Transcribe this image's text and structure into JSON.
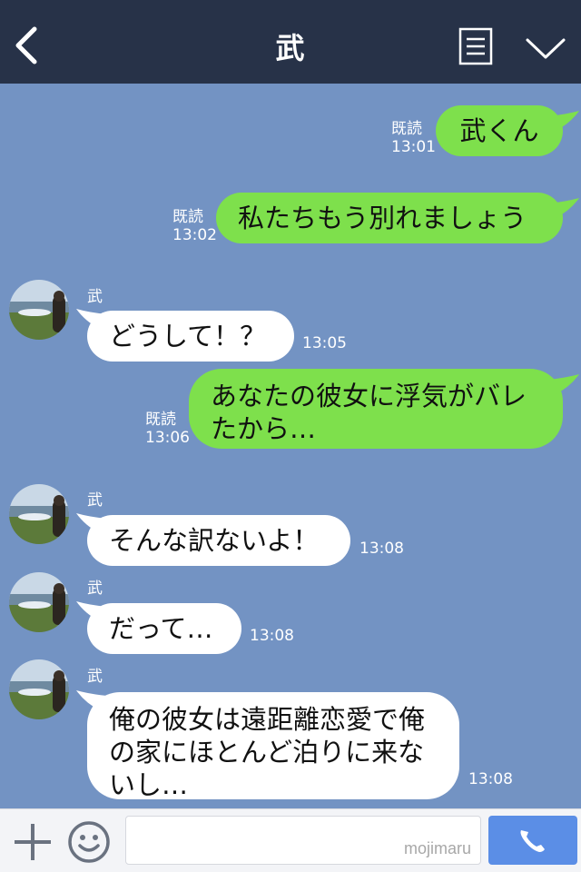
{
  "header": {
    "title": "武",
    "back_icon": "chevron-left-icon",
    "menu_icon": "list-icon",
    "more_icon": "chevron-down-icon"
  },
  "messages": [
    {
      "direction": "out",
      "text": "武くん",
      "read": "既読",
      "time": "13:01"
    },
    {
      "direction": "out",
      "text": "私たちもう別れましょう",
      "read": "既読",
      "time": "13:02"
    },
    {
      "direction": "in",
      "sender": "武",
      "text": "どうして！？",
      "time": "13:05"
    },
    {
      "direction": "out",
      "lines": [
        "あなたの彼女に浮気がバレ",
        "たから…"
      ],
      "read": "既読",
      "time": "13:06"
    },
    {
      "direction": "in",
      "sender": "武",
      "text": "そんな訳ないよ！",
      "time": "13:08"
    },
    {
      "direction": "in",
      "sender": "武",
      "text": "だって…",
      "time": "13:08"
    },
    {
      "direction": "in",
      "sender": "武",
      "lines": [
        "俺の彼女は遠距離恋愛で俺",
        "の家にほとんど泊りに来な",
        "いし…"
      ],
      "time": "13:08"
    }
  ],
  "footer": {
    "plus_icon": "plus-icon",
    "emoji_icon": "smile-icon",
    "input_value": "",
    "watermark": "mojimaru",
    "call_icon": "phone-icon"
  },
  "colors": {
    "header_bg": "#273248",
    "chat_bg": "#7393c3",
    "outgoing_bubble": "#7ee04c",
    "incoming_bubble": "#ffffff",
    "call_button": "#5b8ee6"
  }
}
